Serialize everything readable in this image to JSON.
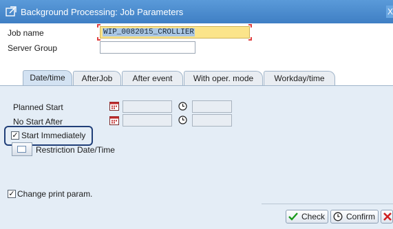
{
  "window": {
    "title": "Background Processing: Job Parameters",
    "close_glyph": "X"
  },
  "header_fields": {
    "job_name_label": "Job name",
    "job_name_value": "WIP_0082015_CROLLIER",
    "server_group_label": "Server Group",
    "server_group_value": ""
  },
  "tabs": [
    {
      "label": "Date/time",
      "active": true
    },
    {
      "label": "AfterJob",
      "active": false
    },
    {
      "label": "After event",
      "active": false
    },
    {
      "label": "With oper. mode",
      "active": false
    },
    {
      "label": "Workday/time",
      "active": false
    }
  ],
  "date_time_tab": {
    "planned_start_label": "Planned Start",
    "no_start_after_label": "No Start After",
    "start_immediately_label": "Start Immediately",
    "start_immediately_checked": true,
    "restriction_label": "Restriction Date/Time"
  },
  "change_print_param": {
    "label": "Change print param.",
    "checked": true
  },
  "buttons": {
    "check": "Check",
    "confirm": "Confirm"
  },
  "colors": {
    "title_bar": "#4a8bd0",
    "required_field": "#fbe48a",
    "highlight": "#1f3e78",
    "cancel": "#d02020"
  },
  "icons": [
    "window-icon",
    "calendar-icon",
    "clock-icon",
    "restriction-icon",
    "check-icon",
    "confirm-icon",
    "cancel-icon"
  ]
}
